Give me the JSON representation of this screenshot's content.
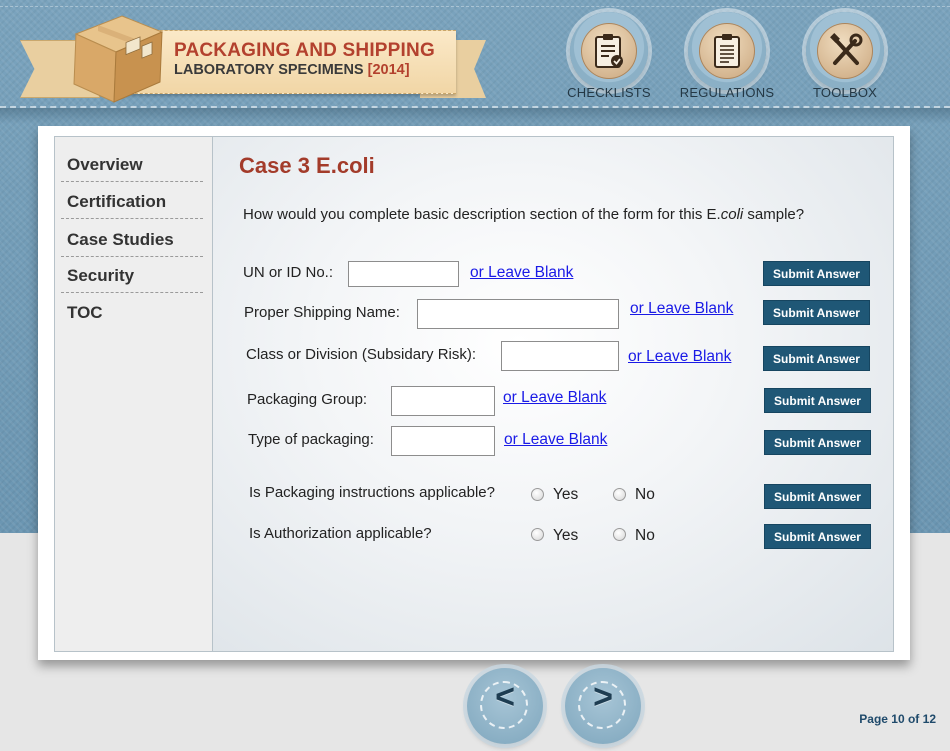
{
  "header": {
    "title_line1": "PACKAGING AND SHIPPING",
    "title_line2": "LABORATORY SPECIMENS",
    "title_year": "[2014]",
    "nav": [
      {
        "label": "CHECKLISTS",
        "icon": "checklist-icon"
      },
      {
        "label": "REGULATIONS",
        "icon": "clipboard-icon"
      },
      {
        "label": "TOOLBOX",
        "icon": "tools-icon"
      }
    ]
  },
  "sidebar": {
    "items": [
      {
        "label": "Overview"
      },
      {
        "label": "Certification"
      },
      {
        "label": "Case Studies"
      },
      {
        "label": "Security"
      },
      {
        "label": "TOC"
      }
    ]
  },
  "main": {
    "case_title": "Case 3 E.coli",
    "question_pre": "How would you complete basic description section of the form for this E.",
    "question_italic": "coli",
    "question_post": " sample?",
    "fields": [
      {
        "label": "UN or ID No.:",
        "value": "",
        "blank_link": "or Leave Blank",
        "submit": "Submit Answer"
      },
      {
        "label": "Proper Shipping Name:",
        "value": "",
        "blank_link": "or Leave Blank",
        "submit": "Submit Answer"
      },
      {
        "label": "Class or Division (Subsidary Risk):",
        "value": "",
        "blank_link": "or Leave Blank",
        "submit": "Submit Answer"
      },
      {
        "label": "Packaging Group:",
        "value": "",
        "blank_link": "or Leave Blank",
        "submit": "Submit Answer"
      },
      {
        "label": "Type of packaging:",
        "value": "",
        "blank_link": "or Leave Blank",
        "submit": "Submit Answer"
      }
    ],
    "radio_questions": [
      {
        "label": "Is Packaging instructions applicable?",
        "yes": "Yes",
        "no": "No",
        "submit": "Submit Answer"
      },
      {
        "label": "Is Authorization applicable?",
        "yes": "Yes",
        "no": "No",
        "submit": "Submit Answer"
      }
    ]
  },
  "footer": {
    "prev_glyph": "<",
    "next_glyph": ">",
    "page_label": "Page 10 of 12"
  },
  "colors": {
    "accent_red": "#a33b2a",
    "submit_blue": "#1f5776",
    "link_blue": "#1a1ae6",
    "header_blue": "#6b96b2"
  }
}
